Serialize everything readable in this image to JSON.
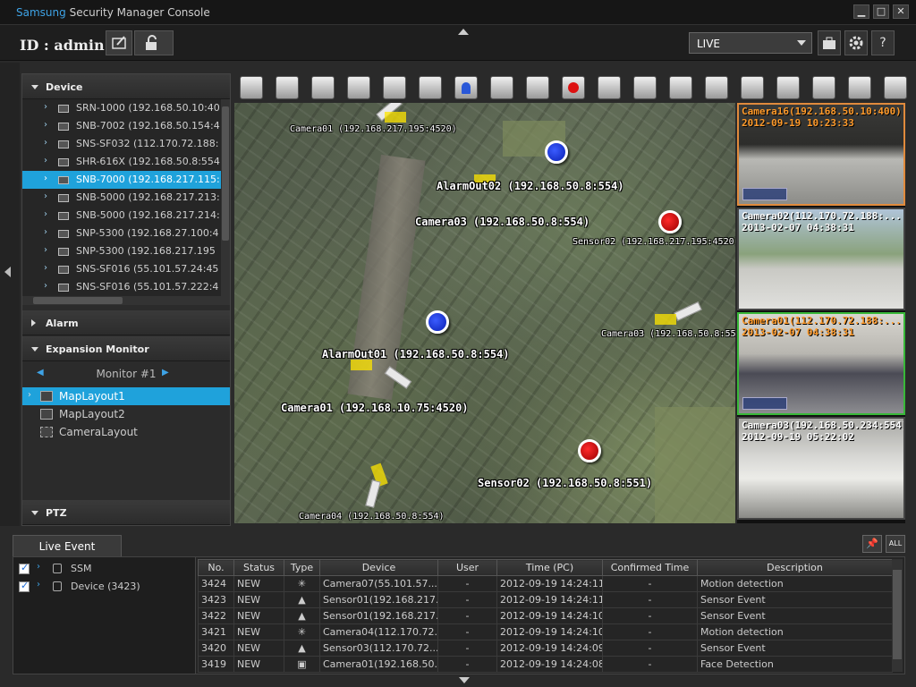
{
  "window": {
    "brand": "Samsung",
    "title_rest": "Security Manager Console",
    "minimize": "▁",
    "maximize": "□",
    "close": "✕"
  },
  "header": {
    "user_label": "ID : admin",
    "mode": "LIVE",
    "help_label": "?"
  },
  "device_section": {
    "title": "Device",
    "items": [
      {
        "label": "SRN-1000 (192.168.50.10:40"
      },
      {
        "label": "SNB-7002 (192.168.50.154:4"
      },
      {
        "label": "SNS-SF032 (112.170.72.188:"
      },
      {
        "label": "SHR-616X (192.168.50.8:554"
      },
      {
        "label": "SNB-7000 (192.168.217.115:",
        "selected": true
      },
      {
        "label": "SNB-5000 (192.168.217.213:"
      },
      {
        "label": "SNB-5000 (192.168.217.214:"
      },
      {
        "label": "SNP-5300 (192.168.27.100:4"
      },
      {
        "label": "SNP-5300 (192.168.217.195"
      },
      {
        "label": "SNS-SF016 (55.101.57.24:45"
      },
      {
        "label": "SNS-SF016 (55.101.57.222:4"
      }
    ]
  },
  "alarm_section": {
    "title": "Alarm"
  },
  "expansion_section": {
    "title": "Expansion Monitor",
    "monitor": "Monitor #1",
    "layouts": [
      {
        "label": "MapLayout1",
        "selected": true
      },
      {
        "label": "MapLayout2"
      },
      {
        "label": "CameraLayout"
      }
    ]
  },
  "ptz_section": {
    "title": "PTZ"
  },
  "toolbar": {
    "buttons": [
      "fullscreen-icon",
      "monitor-split-icon",
      "layout-4-icon",
      "layout-grid-icon",
      "windows-icon",
      "display-icon",
      "alarm-light-icon",
      "camera-snapshot-icon",
      "print-icon",
      "record-icon",
      "playback-icon",
      "speaker-icon",
      "volume-icon",
      "microphone-icon",
      "zoom-in-icon",
      "zoom-out-icon",
      "zoom-fit-icon",
      "brightness-icon",
      "contrast-icon"
    ]
  },
  "map": {
    "labels": [
      {
        "text": "Camera01 (192.168.217.195:4520)",
        "size": "sm"
      },
      {
        "text": "AlarmOut02 (192.168.50.8:554)",
        "size": "lg"
      },
      {
        "text": "Camera03 (192.168.50.8:554)",
        "size": "lg"
      },
      {
        "text": "Sensor02 (192.168.217.195:4520)",
        "size": "sm"
      },
      {
        "text": "Camera03 (192.168.50.8:55",
        "size": "sm"
      },
      {
        "text": "AlarmOut01 (192.168.50.8:554)",
        "size": "lg"
      },
      {
        "text": "Camera01 (192.168.10.75:4520)",
        "size": "lg"
      },
      {
        "text": "Sensor02 (192.168.50.8:551)",
        "size": "lg"
      },
      {
        "text": "Camera04 (192.168.50.8:554)",
        "size": "sm"
      }
    ]
  },
  "cameras": [
    {
      "name": "Camera16(192.168.50.10:400)",
      "time": "2012-09-19 10:23:33"
    },
    {
      "name": "Camera02(112.170.72.188:...",
      "time": "2013-02-07 04:38:31"
    },
    {
      "name": "Camera01(112.170.72.188:...",
      "time": "2013-02-07 04:38:31"
    },
    {
      "name": "Camera03(192.168.50.234:554)",
      "time": "2012-09-19 05:22:02"
    }
  ],
  "live_event": {
    "tab": "Live Event",
    "pin_label": "📌",
    "clear_label": "ALL",
    "tree": [
      {
        "label": "SSM"
      },
      {
        "label": "Device (3423)"
      }
    ],
    "columns": [
      "No.",
      "Status",
      "Type",
      "Device",
      "User",
      "Time (PC)",
      "Confirmed Time",
      "Description"
    ],
    "rows": [
      {
        "no": "3424",
        "status": "NEW",
        "type": "✳",
        "device": "Camera07(55.101.57....",
        "user": "-",
        "time": "2012-09-19 14:24:11",
        "confirmed": "-",
        "desc": "Motion detection"
      },
      {
        "no": "3423",
        "status": "NEW",
        "type": "▲",
        "device": "Sensor01(192.168.217....",
        "user": "-",
        "time": "2012-09-19 14:24:11",
        "confirmed": "-",
        "desc": "Sensor Event"
      },
      {
        "no": "3422",
        "status": "NEW",
        "type": "▲",
        "device": "Sensor01(192.168.217....",
        "user": "-",
        "time": "2012-09-19 14:24:10",
        "confirmed": "-",
        "desc": "Sensor Event"
      },
      {
        "no": "3421",
        "status": "NEW",
        "type": "✳",
        "device": "Camera04(112.170.72....",
        "user": "-",
        "time": "2012-09-19 14:24:10",
        "confirmed": "-",
        "desc": "Motion detection"
      },
      {
        "no": "3420",
        "status": "NEW",
        "type": "▲",
        "device": "Sensor03(112.170.72....",
        "user": "-",
        "time": "2012-09-19 14:24:09",
        "confirmed": "-",
        "desc": "Sensor Event"
      },
      {
        "no": "3419",
        "status": "NEW",
        "type": "▣",
        "device": "Camera01(192.168.50....",
        "user": "-",
        "time": "2012-09-19 14:24:08",
        "confirmed": "-",
        "desc": "Face Detection"
      }
    ]
  },
  "colors": {
    "accent": "#1fa2db",
    "brand": "#3ea3e6",
    "alarm_red": "#d11111",
    "alarm_blue": "#2a58d8",
    "tile_active_orange": "#e08a3c",
    "tile_active_green": "#38b838"
  }
}
